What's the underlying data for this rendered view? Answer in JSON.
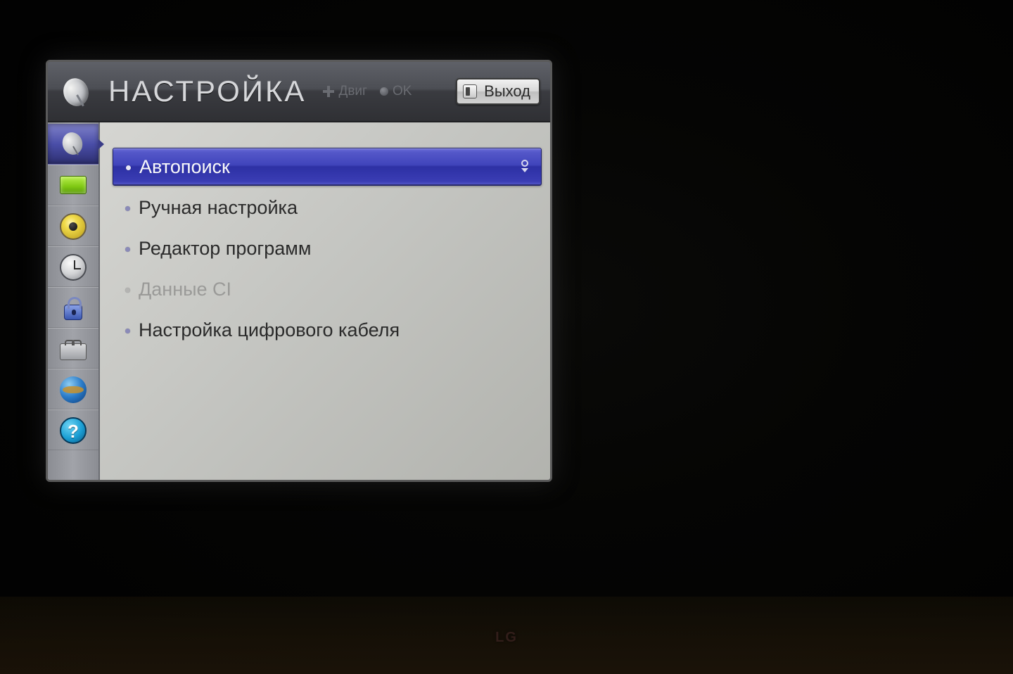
{
  "tv_brand": "LG",
  "header": {
    "title": "НАСТРОЙКА",
    "hint_move": "Двиг",
    "hint_ok": "OK",
    "exit_label": "Выход"
  },
  "sidebar": {
    "items": [
      {
        "name": "setup",
        "selected": true
      },
      {
        "name": "picture",
        "selected": false
      },
      {
        "name": "audio",
        "selected": false
      },
      {
        "name": "time",
        "selected": false
      },
      {
        "name": "lock",
        "selected": false
      },
      {
        "name": "option",
        "selected": false
      },
      {
        "name": "network",
        "selected": false
      },
      {
        "name": "support",
        "selected": false
      }
    ]
  },
  "menu": {
    "items": [
      {
        "label": "Автопоиск",
        "selected": true,
        "disabled": false
      },
      {
        "label": "Ручная настройка",
        "selected": false,
        "disabled": false
      },
      {
        "label": "Редактор программ",
        "selected": false,
        "disabled": false
      },
      {
        "label": "Данные CI",
        "selected": false,
        "disabled": true
      },
      {
        "label": "Настройка цифрового кабеля",
        "selected": false,
        "disabled": false
      }
    ]
  }
}
